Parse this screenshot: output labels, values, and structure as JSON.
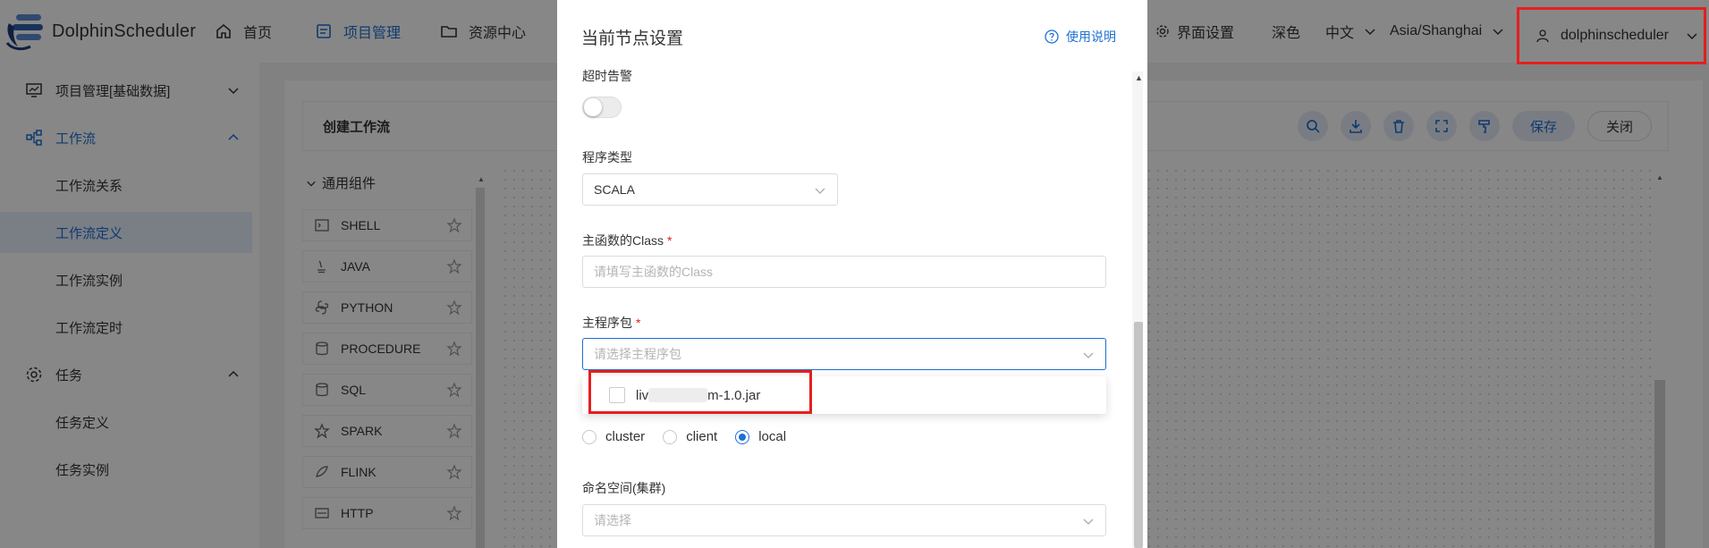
{
  "header": {
    "app_name": "DolphinScheduler",
    "nav": [
      {
        "label": "首页",
        "icon": "home-icon"
      },
      {
        "label": "项目管理",
        "icon": "project-icon",
        "active": true
      },
      {
        "label": "资源中心",
        "icon": "folder-icon"
      }
    ],
    "ui_settings_label": "界面设置",
    "theme_label": "深色",
    "language_label": "中文",
    "timezone_label": "Asia/Shanghai",
    "username": "dolphinscheduler"
  },
  "sidebar": {
    "items": [
      {
        "label": "项目管理[基础数据]",
        "icon": "monitor-icon"
      },
      {
        "label": "工作流",
        "icon": "workflow-icon",
        "expanded": true
      },
      {
        "label": "工作流关系"
      },
      {
        "label": "工作流定义",
        "active": true
      },
      {
        "label": "工作流实例"
      },
      {
        "label": "工作流定时"
      },
      {
        "label": "任务",
        "icon": "gear-icon",
        "expanded": true
      },
      {
        "label": "任务定义"
      },
      {
        "label": "任务实例"
      }
    ]
  },
  "workflow": {
    "title": "创建工作流",
    "save_label": "保存",
    "close_label": "关闭",
    "palette_header": "通用组件",
    "components": [
      "SHELL",
      "JAVA",
      "PYTHON",
      "PROCEDURE",
      "SQL",
      "SPARK",
      "FLINK",
      "HTTP"
    ]
  },
  "drawer": {
    "title": "当前节点设置",
    "help_label": "使用说明",
    "timeout_alarm_label": "超时告警",
    "program_type_label": "程序类型",
    "program_type_value": "SCALA",
    "main_class_label": "主函数的Class",
    "main_class_placeholder": "请填写主函数的Class",
    "main_package_label": "主程序包",
    "main_package_placeholder": "请选择主程序包",
    "package_option_prefix": "liv",
    "package_option_suffix": "m-1.0.jar",
    "deploy_modes": [
      "cluster",
      "client",
      "local"
    ],
    "deploy_mode_selected": "local",
    "namespace_label": "命名空间(集群)",
    "namespace_placeholder": "请选择"
  },
  "colors": {
    "accent": "#1e6fd0",
    "highlight_box": "#e61e1e",
    "overlay": "rgba(0,0,0,0.47)"
  }
}
